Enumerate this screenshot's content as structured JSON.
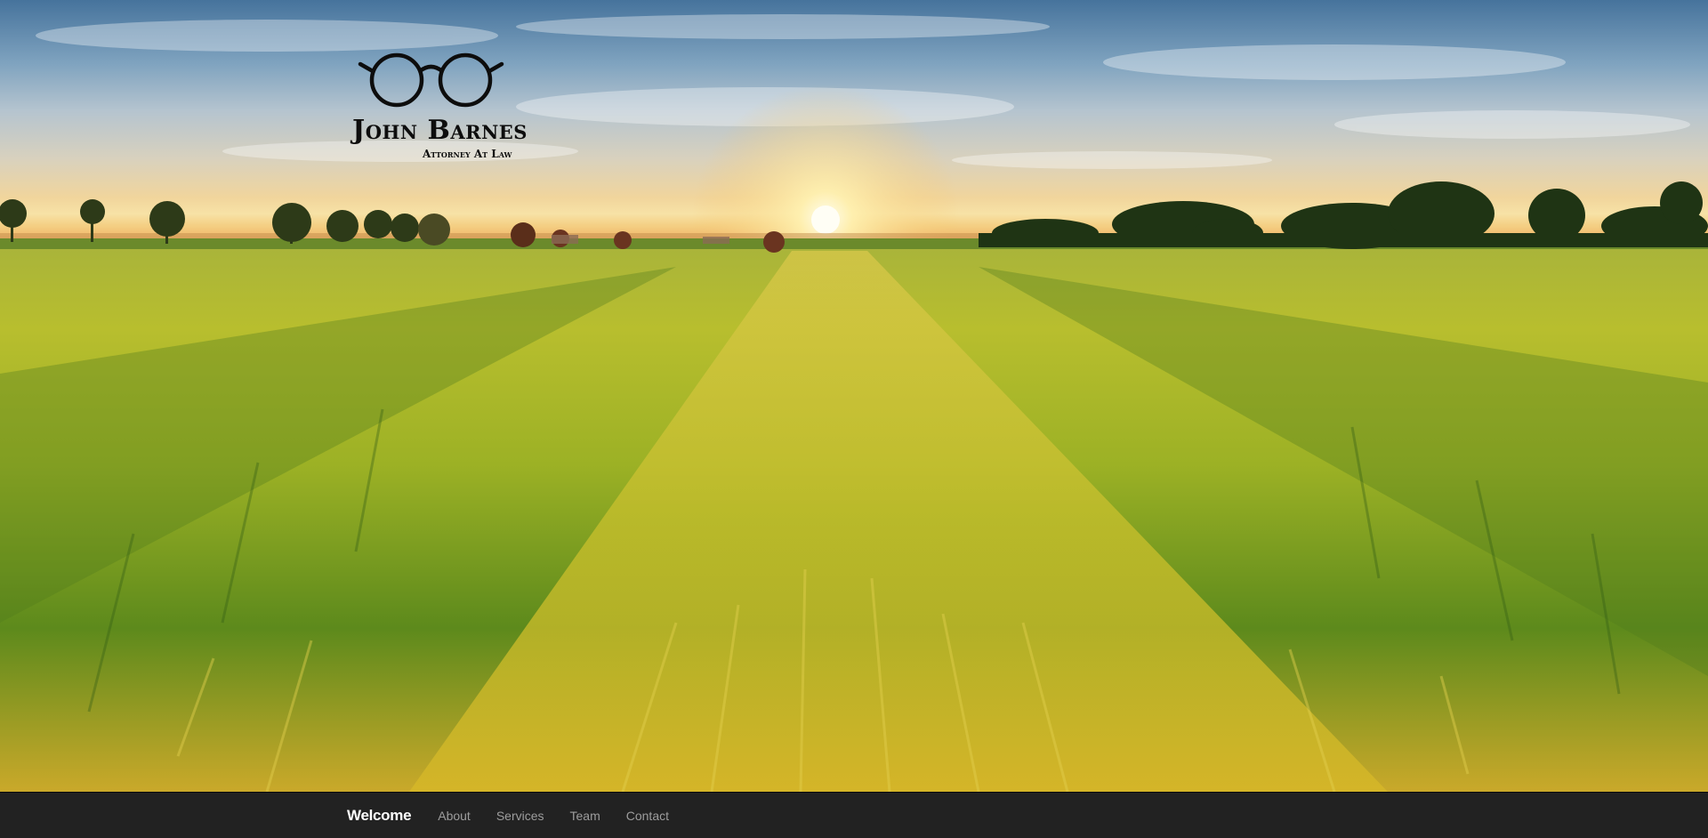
{
  "logo": {
    "name": "John Barnes",
    "subtitle": "Attorney At Law",
    "icon": "glasses-icon"
  },
  "hero": {
    "image": "wheat-field-sunset-landscape"
  },
  "nav": {
    "brand": "Welcome",
    "items": [
      {
        "label": "About"
      },
      {
        "label": "Services"
      },
      {
        "label": "Team"
      },
      {
        "label": "Contact"
      }
    ]
  },
  "colors": {
    "navbar_bg": "#222222",
    "nav_brand": "#ffffff",
    "nav_link": "#9d9d9d",
    "logo_ink": "#0d0d0d"
  }
}
